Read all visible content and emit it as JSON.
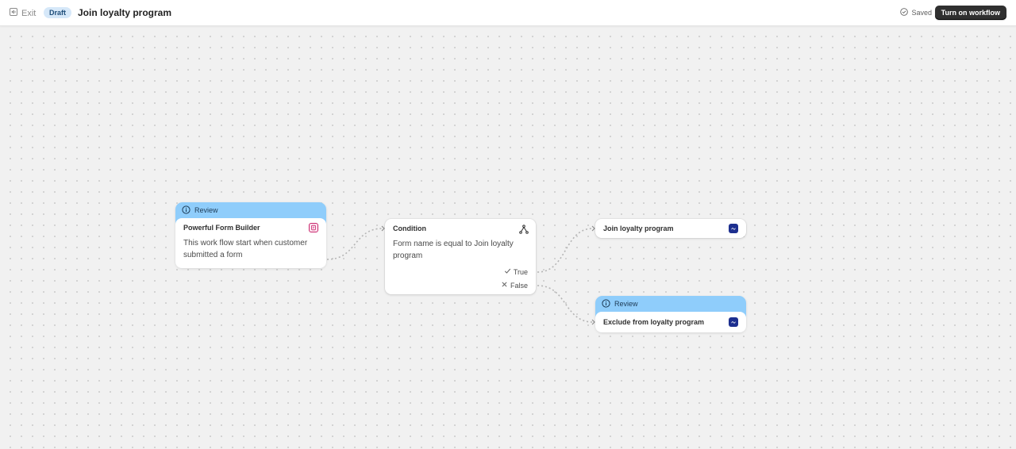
{
  "header": {
    "exit_label": "Exit",
    "status_badge": "Draft",
    "title": "Join loyalty program",
    "saved_label": "Saved",
    "primary_action": "Turn on workflow"
  },
  "nodes": {
    "trigger": {
      "banner": "Review",
      "title": "Powerful Form Builder",
      "description": "This work flow start when customer submitted a form",
      "icon": "form-builder-app-icon"
    },
    "condition": {
      "title": "Condition",
      "description": "Form name is equal to Join loyalty program",
      "icon": "branch-icon",
      "true_label": "True",
      "false_label": "False"
    },
    "action_true": {
      "title": "Join loyalty program",
      "icon": "loyalty-app-icon"
    },
    "action_false": {
      "banner": "Review",
      "title": "Exclude from loyalty program",
      "icon": "loyalty-app-icon"
    }
  },
  "colors": {
    "review_banner": "#8fcdfb",
    "badge_bg": "#d6e8f9",
    "primary_button": "#303030",
    "canvas": "#f1f1f1"
  }
}
